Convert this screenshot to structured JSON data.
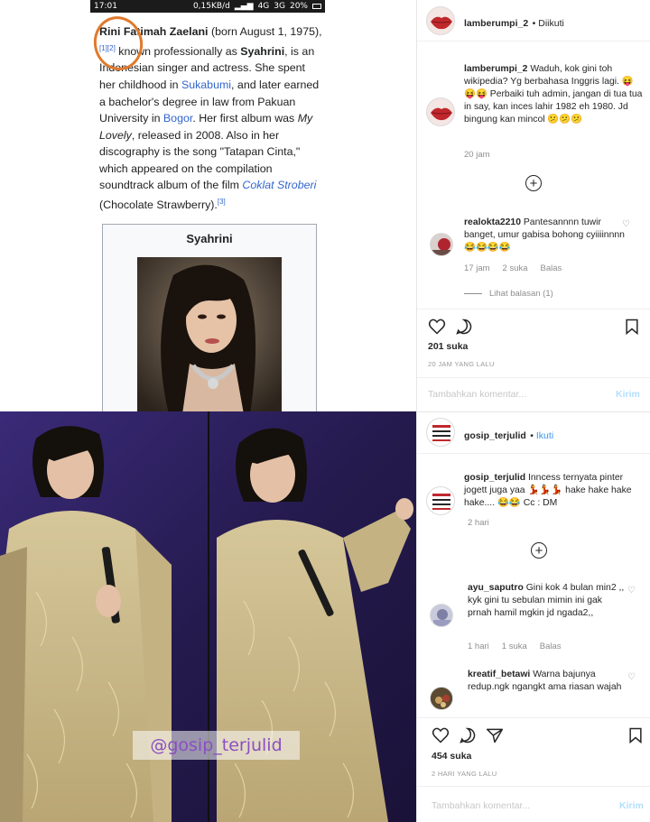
{
  "status_bar": {
    "time": "17:01",
    "speed": "0,15KB/d",
    "network": "4G",
    "network2": "3G",
    "battery": "20%"
  },
  "wiki": {
    "name_bold": "Rini Fatimah Zaelani",
    "born": " (born August 1, 1975),",
    "ref1": "[1]",
    "ref2": "[2]",
    "known_as": " known professionally as ",
    "stage_name": "Syahrini",
    "desc1": ", is an Indonesian singer and actress. She spent her childhood in ",
    "link_sukabumi": "Sukabumi",
    "desc2": ", and later earned a bachelor's degree in law from Pakuan University in ",
    "link_bogor": "Bogor",
    "desc3": ". Her first album was ",
    "album": "My Lovely",
    "desc4": ", released in 2008. Also in her discography is the song \"Tatapan Cinta,\" which appeared on the compilation soundtrack album of the film ",
    "film": "Coklat Stroberi",
    "desc5": " (Chocolate Strawberry).",
    "ref3": "[3]",
    "infobox_title": "Syahrini"
  },
  "ig1": {
    "username": "lamberumpi_2",
    "follow_status": "Diikuti",
    "caption_user": "lamberumpi_2",
    "caption": "Waduh, kok gini toh wikipedia? Yg berbahasa Inggris lagi. 😝😝😝 Perbaiki tuh admin, jangan di tua tua in say, kan inces lahir 1982 eh 1980. Jd bingung kan mincol 😕😕😕",
    "caption_time": "20 jam",
    "comment_user": "realokta2210",
    "comment": "Pantesannnn tuwir banget, umur gabisa bohong cyiiiinnnn 😂😂😂😂",
    "comment_time": "17 jam",
    "comment_likes": "2 suka",
    "comment_reply": "Balas",
    "view_replies": "Lihat balasan (1)",
    "likes": "201 suka",
    "timeago": "20 JAM YANG LALU",
    "add_comment": "Tambahkan komentar...",
    "send": "Kirim"
  },
  "ig2": {
    "username": "gosip_terjulid",
    "follow_status": "Ikuti",
    "caption_user": "gosip_terjulid",
    "caption": "Inncess ternyata pinter jogett juga yaa 💃💃💃 hake hake hake hake.... 😂😂 Cc : DM",
    "caption_time": "2 hari",
    "comment1_user": "ayu_saputro",
    "comment1": "Gini kok 4 bulan min2 ,, kyk gini tu sebulan mimin ini gak prnah hamil mgkin jd ngada2,,",
    "comment1_time": "1 hari",
    "comment1_likes": "1 suka",
    "comment1_reply": "Balas",
    "comment2_user": "kreatif_betawi",
    "comment2": "Warna bajunya redup.ngk ngangkt ama riasan wajah",
    "likes": "454 suka",
    "timeago": "2 HARI YANG LALU",
    "add_comment": "Tambahkan komentar...",
    "send": "Kirim"
  },
  "watermark": "@gosip_terjulid",
  "colors": {
    "accent_orange": "#e07a2c",
    "ig_blue": "#3897f0",
    "wiki_link": "#3366cc"
  }
}
